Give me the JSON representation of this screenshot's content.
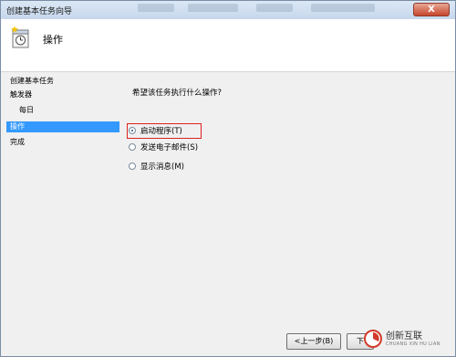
{
  "window": {
    "title": "创建基本任务向导",
    "close_glyph": "X"
  },
  "header": {
    "title": "操作",
    "icon": "task-scheduler-icon"
  },
  "steps": [
    {
      "label": "创建基本任务",
      "active": false
    },
    {
      "label": "触发器",
      "active": false
    },
    {
      "label": "每日",
      "active": false
    },
    {
      "label": "操作",
      "active": true
    },
    {
      "label": "完成",
      "active": false
    }
  ],
  "content": {
    "question": "希望该任务执行什么操作?",
    "options": [
      {
        "label": "启动程序(T)",
        "checked": true
      },
      {
        "label": "发送电子邮件(S)",
        "checked": false
      },
      {
        "label": "显示消息(M)",
        "checked": false
      }
    ]
  },
  "buttons": {
    "back": "<上一步(B)",
    "next": "下"
  },
  "watermark": {
    "name": "创新互联",
    "sub": "CHUANG XIN HU LIAN"
  },
  "colors": {
    "accent": "#3399ff",
    "highlight": "#e02020"
  }
}
